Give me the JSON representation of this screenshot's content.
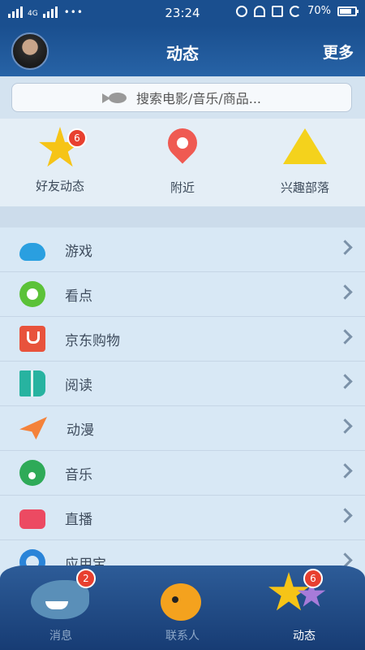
{
  "status_bar": {
    "time": "23:24",
    "network": "4G",
    "battery": "70%"
  },
  "header": {
    "title": "动态",
    "more_label": "更多"
  },
  "search": {
    "placeholder": "搜索电影/音乐/商品..."
  },
  "quick_actions": [
    {
      "label": "好友动态",
      "icon": "qzone-star-icon",
      "badge": "6"
    },
    {
      "label": "附近",
      "icon": "location-pin-icon"
    },
    {
      "label": "兴趣部落",
      "icon": "tent-icon"
    }
  ],
  "menu": [
    {
      "label": "游戏",
      "icon": "gamepad-icon"
    },
    {
      "label": "看点",
      "icon": "eye-icon"
    },
    {
      "label": "京东购物",
      "icon": "shopping-bag-icon"
    },
    {
      "label": "阅读",
      "icon": "book-icon"
    },
    {
      "label": "动漫",
      "icon": "paper-plane-icon"
    },
    {
      "label": "音乐",
      "icon": "music-note-icon"
    },
    {
      "label": "直播",
      "icon": "video-camera-icon"
    },
    {
      "label": "应用宝",
      "icon": "app-store-icon"
    }
  ],
  "tabs": [
    {
      "label": "消息",
      "badge": "2",
      "icon": "shark-icon"
    },
    {
      "label": "联系人",
      "icon": "fish-icon"
    },
    {
      "label": "动态",
      "badge": "6",
      "icon": "starfish-icon",
      "active": true
    }
  ],
  "colors": {
    "header": "#1a4f8f",
    "accent_badge": "#e8402f",
    "list_bg": "#d8e8f5"
  }
}
